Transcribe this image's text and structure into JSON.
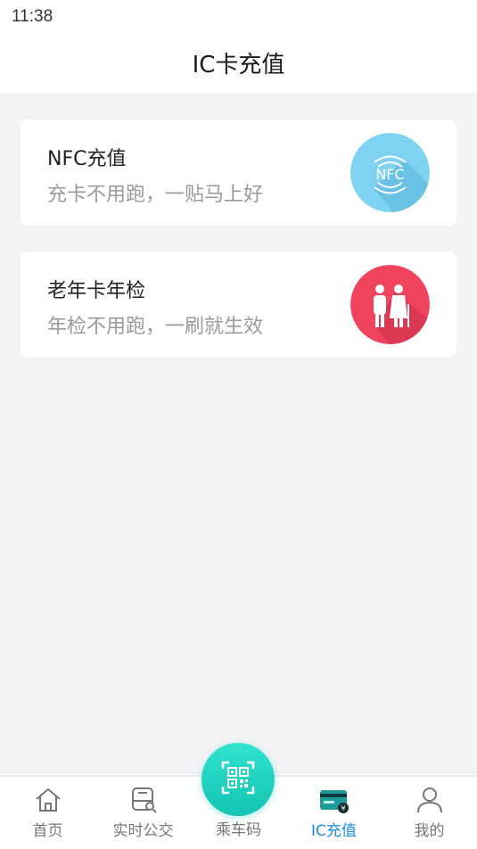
{
  "status_bar": {
    "time": "11:38"
  },
  "header": {
    "title": "IC卡充值"
  },
  "cards": [
    {
      "title": "NFC充值",
      "subtitle": "充卡不用跑，一贴马上好",
      "icon": "nfc-icon",
      "icon_color": "#7fd3f0",
      "icon_text": "NFC"
    },
    {
      "title": "老年卡年检",
      "subtitle": "年检不用跑，一刷就生效",
      "icon": "elderly-couple-icon",
      "icon_color": "#f0445e"
    }
  ],
  "tabs": [
    {
      "label": "首页",
      "icon": "home-icon",
      "active": false
    },
    {
      "label": "实时公交",
      "icon": "bus-search-icon",
      "active": false
    },
    {
      "label": "乘车码",
      "icon": "qr-code-icon",
      "active": false
    },
    {
      "label": "IC充值",
      "icon": "card-recharge-icon",
      "active": true
    },
    {
      "label": "我的",
      "icon": "person-icon",
      "active": false
    }
  ],
  "colors": {
    "accent": "#1a8de0",
    "qr_button": "#1fd3c0",
    "background": "#f2f3f5"
  }
}
